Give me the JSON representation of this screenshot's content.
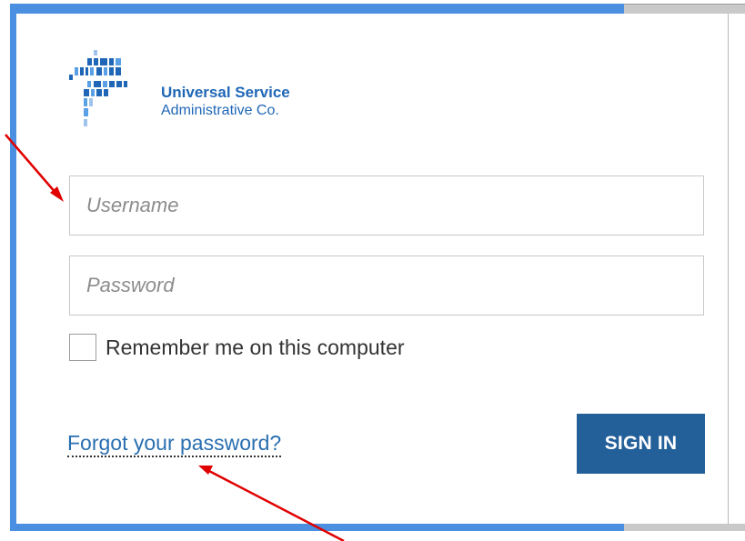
{
  "logo": {
    "line1": "Universal Service",
    "line2": "Administrative Co.",
    "icon": "usac-logo-icon"
  },
  "form": {
    "username_placeholder": "Username",
    "password_placeholder": "Password",
    "username_value": "",
    "password_value": "",
    "remember_label": "Remember me on this computer",
    "remember_checked": false,
    "forgot_label": "Forgot your password?",
    "signin_label": "SIGN IN"
  },
  "colors": {
    "frame_blue": "#4a8fe0",
    "brand_blue": "#1f67b6",
    "button_blue": "#23609a",
    "link_blue": "#2a6fb0",
    "arrow_red": "#e00000"
  },
  "annotations": {
    "arrows": [
      "arrow-to-username-field",
      "arrow-to-forgot-password-link"
    ]
  }
}
